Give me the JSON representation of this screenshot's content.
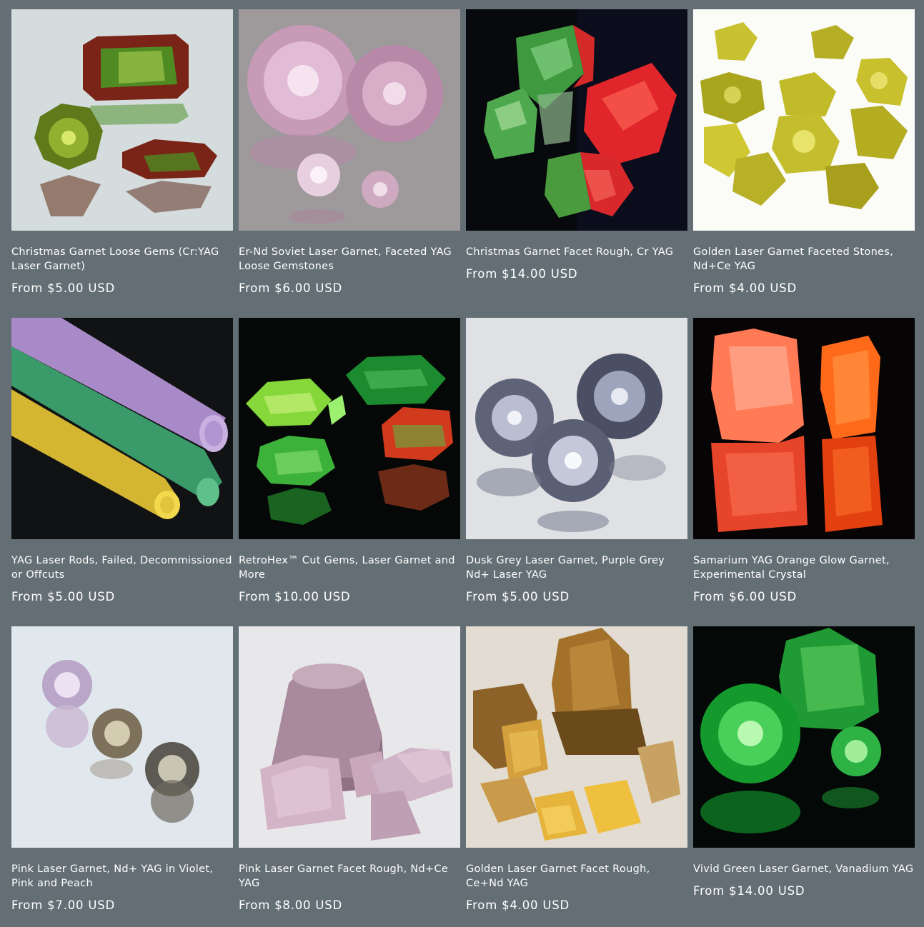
{
  "products": [
    {
      "title": "Christmas Garnet Loose Gems (Cr:YAG Laser Garnet)",
      "price": "From $5.00 USD",
      "image": "christmas-garnet-gems-image"
    },
    {
      "title": "Er-Nd Soviet Laser Garnet, Faceted YAG Loose Gemstones",
      "price": "From $6.00 USD",
      "image": "pink-soviet-garnet-image"
    },
    {
      "title": "Christmas Garnet Facet Rough, Cr YAG",
      "price": "From $14.00 USD",
      "image": "christmas-garnet-rough-image"
    },
    {
      "title": "Golden Laser Garnet Faceted Stones, Nd+Ce YAG",
      "price": "From $4.00 USD",
      "image": "golden-faceted-stones-image"
    },
    {
      "title": "YAG Laser Rods, Failed, Decommissioned or Offcuts",
      "price": "From $5.00 USD",
      "image": "yag-laser-rods-image"
    },
    {
      "title": "RetroHex™ Cut Gems, Laser Garnet and More",
      "price": "From $10.00 USD",
      "image": "retrohex-gems-image"
    },
    {
      "title": "Dusk Grey Laser Garnet, Purple Grey Nd+ Laser YAG",
      "price": "From $5.00 USD",
      "image": "dusk-grey-garnet-image"
    },
    {
      "title": "Samarium YAG Orange Glow Garnet, Experimental Crystal",
      "price": "From $6.00 USD",
      "image": "samarium-orange-crystal-image"
    },
    {
      "title": "Pink Laser Garnet, Nd+ YAG in Violet, Pink and Peach",
      "price": "From $7.00 USD",
      "image": "pink-laser-garnet-image"
    },
    {
      "title": "Pink Laser Garnet Facet Rough, Nd+Ce YAG",
      "price": "From $8.00 USD",
      "image": "pink-facet-rough-image"
    },
    {
      "title": "Golden Laser Garnet Facet Rough, Ce+Nd YAG",
      "price": "From $4.00 USD",
      "image": "golden-facet-rough-image"
    },
    {
      "title": "Vivid Green Laser Garnet, Vanadium YAG",
      "price": "From $14.00 USD",
      "image": "vivid-green-garnet-image"
    }
  ],
  "colors": {
    "page_background": "#646f75",
    "text": "#ffffff"
  }
}
